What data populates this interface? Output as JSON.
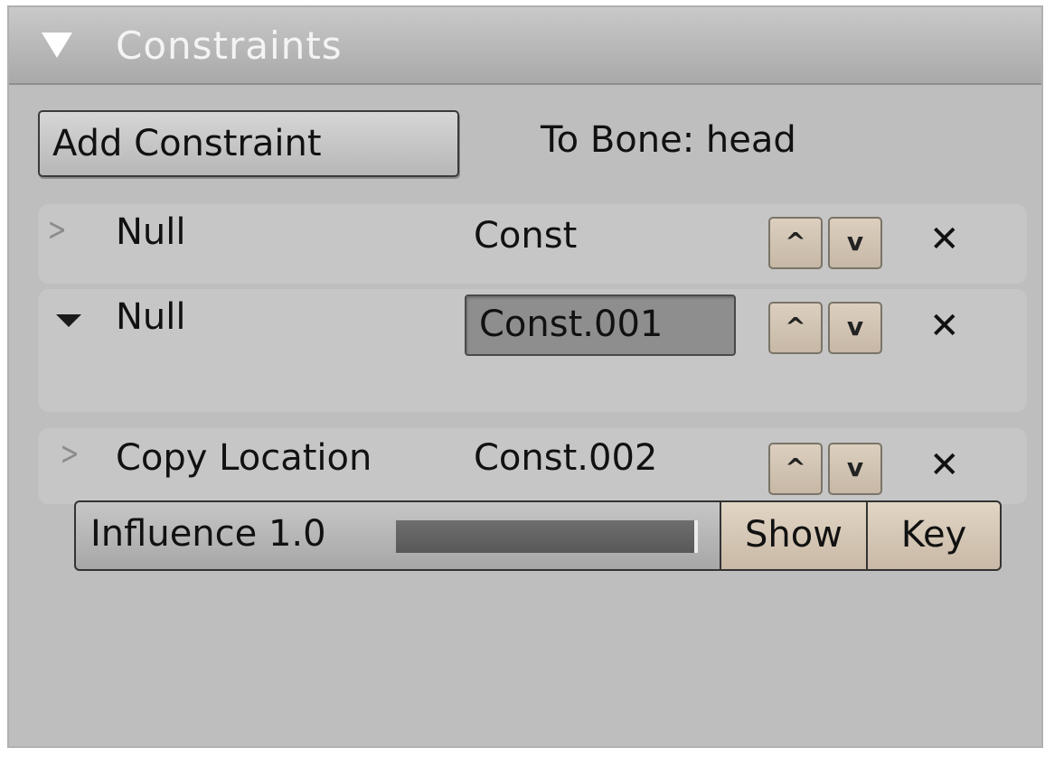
{
  "panel": {
    "title": "Constraints"
  },
  "toolbar": {
    "add_constraint_label": "Add Constraint",
    "to_bone_text": "To Bone: head"
  },
  "constraints": [
    {
      "type": "Null",
      "name": "Const",
      "expanded": false
    },
    {
      "type": "Null",
      "name": "Const.001",
      "expanded": true
    },
    {
      "type": "Copy Location",
      "name": "Const.002",
      "expanded": false
    }
  ],
  "controls": {
    "move_up_glyph": "^",
    "move_down_glyph": "v",
    "delete_glyph": "✕",
    "collapsed_glyph": ">"
  },
  "influence": {
    "label": "Influence 1.0",
    "value": 1.0,
    "show_label": "Show",
    "key_label": "Key"
  }
}
